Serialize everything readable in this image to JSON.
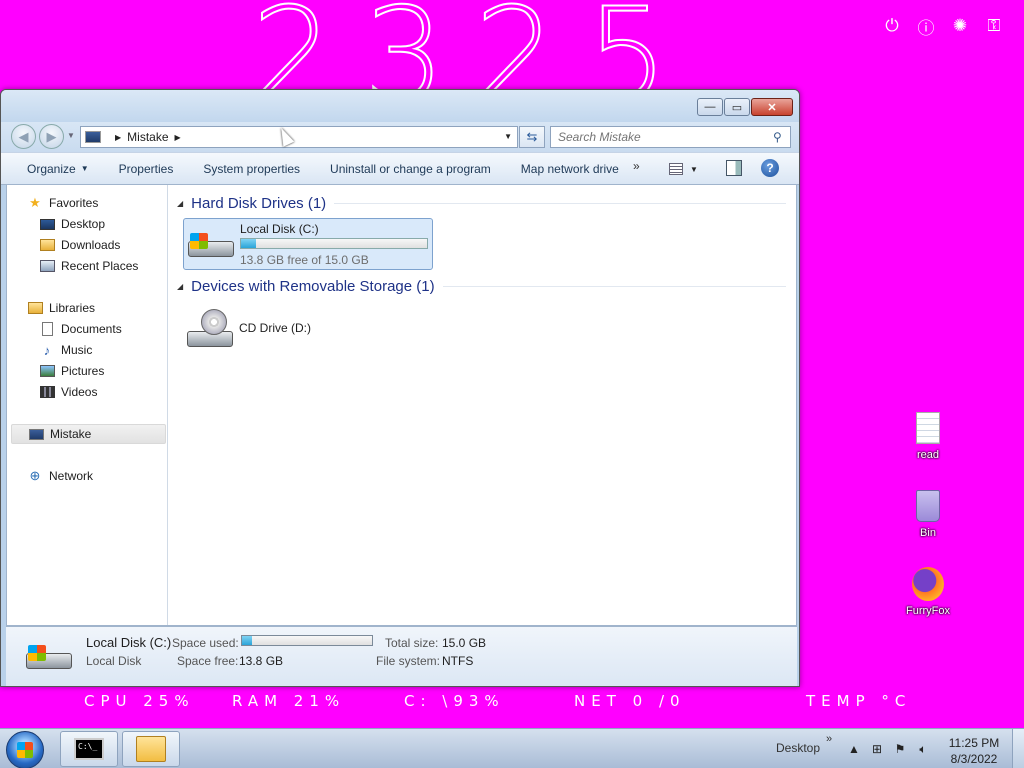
{
  "desktop": {
    "bg_color": "#ff00ff",
    "clock_big": "2325",
    "sys_icons": [
      "power-icon",
      "info-icon",
      "loading-icon",
      "key-icon"
    ],
    "icons": [
      {
        "label": "read",
        "icon": "text-file-icon"
      },
      {
        "label": "Bin",
        "icon": "recycle-bin-icon"
      },
      {
        "label": "FurryFox",
        "icon": "firefox-icon"
      }
    ],
    "stats": {
      "cpu": "CPU  25%",
      "ram": "RAM  21%",
      "disk": "C: \\93%",
      "net": "NET  0 /0",
      "temp": "TEMP  °C"
    }
  },
  "window": {
    "caption": {
      "minimize": "—",
      "maximize": "▭",
      "close": "✕"
    },
    "address": {
      "location": "Mistake"
    },
    "search": {
      "placeholder": "Search Mistake"
    },
    "commands": [
      {
        "label": "Organize",
        "dropdown": true
      },
      {
        "label": "Properties"
      },
      {
        "label": "System properties"
      },
      {
        "label": "Uninstall or change a program"
      },
      {
        "label": "Map network drive"
      }
    ],
    "more_label": "»",
    "help_label": "?",
    "nav": {
      "favorites": "Favorites",
      "desktop": "Desktop",
      "downloads": "Downloads",
      "recent": "Recent Places",
      "libraries": "Libraries",
      "documents": "Documents",
      "music": "Music",
      "pictures": "Pictures",
      "videos": "Videos",
      "computer": "Mistake",
      "network": "Network"
    },
    "groups": {
      "hdd": "Hard Disk Drives (1)",
      "removable": "Devices with Removable Storage (1)"
    },
    "drives": [
      {
        "name": "Local Disk (C:)",
        "free_text": "13.8 GB free of 15.0 GB",
        "used_fraction": 0.08
      },
      {
        "name": "CD Drive (D:)"
      }
    ],
    "details": {
      "name": "Local Disk (C:)",
      "type": "Local Disk",
      "space_used_label": "Space used:",
      "space_free_label": "Space free:",
      "space_free": "13.8 GB",
      "total_size_label": "Total size:",
      "total_size": "15.0 GB",
      "file_system_label": "File system:",
      "file_system": "NTFS",
      "used_fraction": 0.08
    }
  },
  "taskbar": {
    "desktop_label": "Desktop",
    "chevron": "»",
    "time": "11:25 PM",
    "date": "8/3/2022",
    "cmd_text": "C:\\_"
  }
}
